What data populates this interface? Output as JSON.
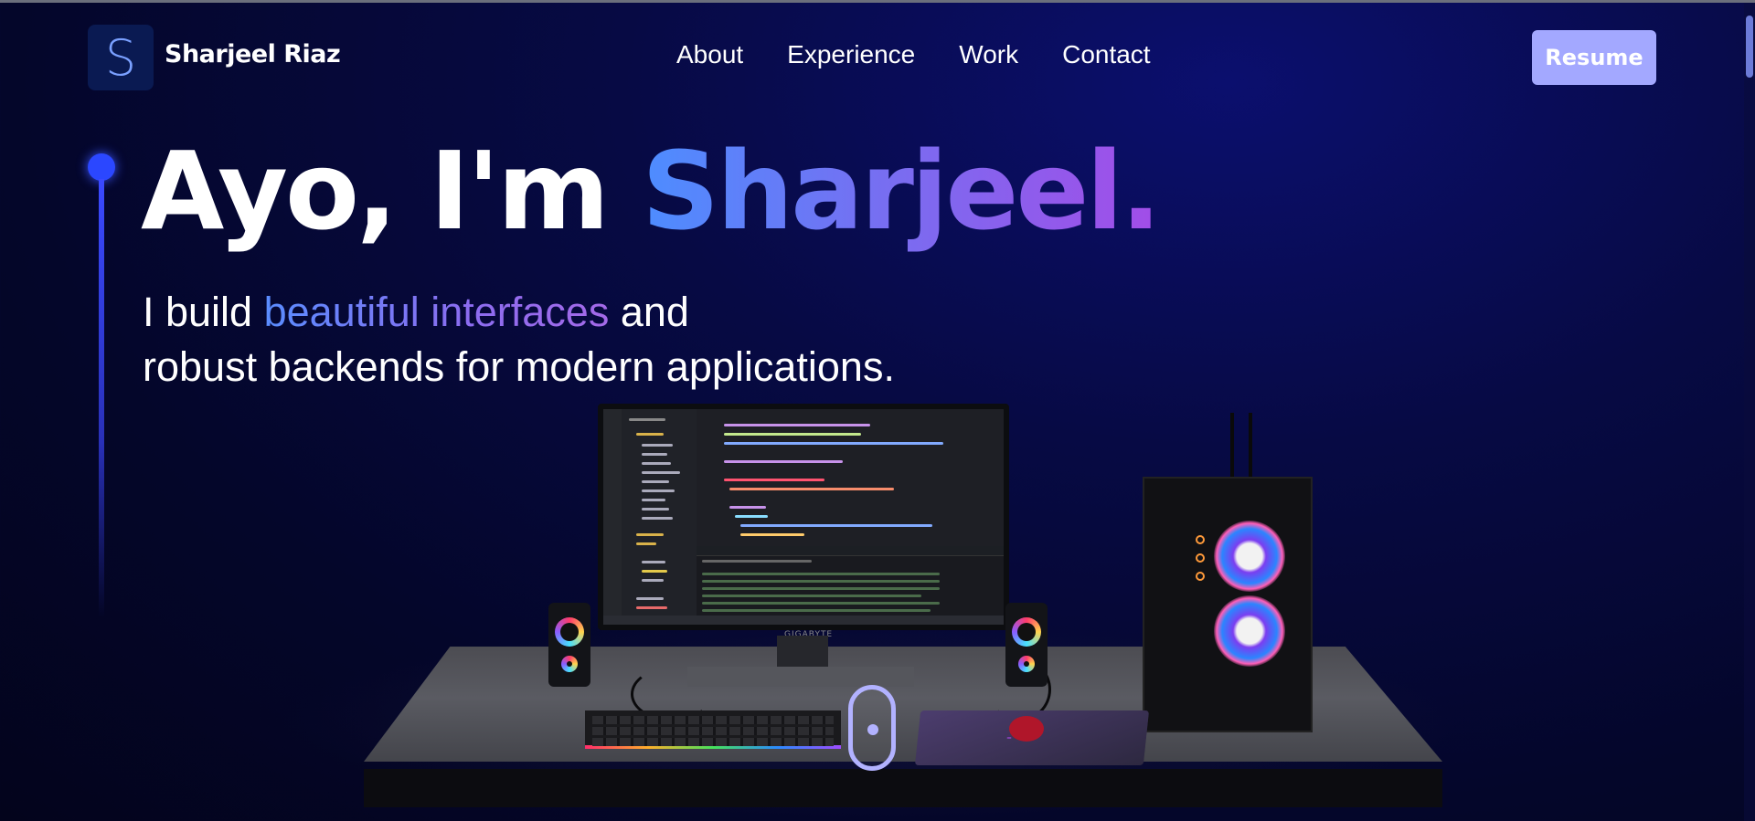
{
  "brand": {
    "logo_letter": "S",
    "name": "Sharjeel Riaz"
  },
  "nav": {
    "items": [
      "About",
      "Experience",
      "Work",
      "Contact"
    ]
  },
  "resume_label": "Resume",
  "hero": {
    "title_plain": "Ayo, I'm ",
    "title_highlight": "Sharjeel.",
    "sub_line1_a": "I build ",
    "sub_line1_highlight": "beautiful interfaces",
    "sub_line1_b": " and",
    "sub_line2": "robust backends for modern applications."
  },
  "scene": {
    "monitor_brand": "GIGABYTE"
  },
  "colors": {
    "accent_blue": "#4d8dff",
    "accent_purple": "#a24de8",
    "resume_bg": "#a3a8ff",
    "timeline": "#2b47ff"
  }
}
